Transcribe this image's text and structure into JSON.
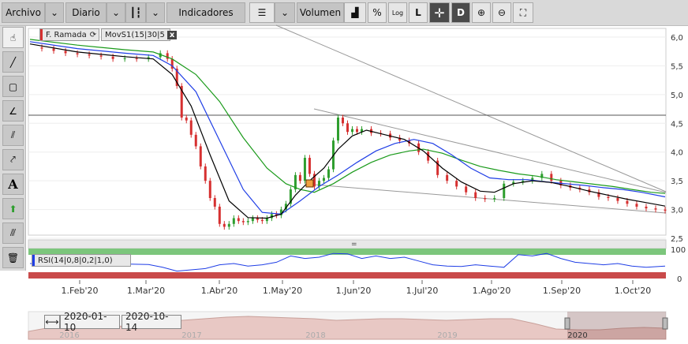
{
  "toolbar": {
    "archivo": "Archivo",
    "diario": "Diario",
    "indicadores": "Indicadores",
    "volumen": "Volumen",
    "percent": "%",
    "log": "Log"
  },
  "legend": {
    "main_series": "F. Ramada",
    "indicator": "MovS1(15|30|5",
    "close": "x",
    "rsi": "RSI(14|0,8|0,2|1,0)"
  },
  "colors": {
    "up": "#2e9e2e",
    "down": "#d63030",
    "ma_short": "#000000",
    "ma_mid": "#1f3ee6",
    "ma_long": "#1a9a1a",
    "rsi_line": "#1f3ee6",
    "rsi_high_band": "#7cc67c",
    "rsi_low_band": "#c94a4a"
  },
  "chart_data": {
    "type": "candlestick",
    "y_ticks": [
      "6,0",
      "5,5",
      "5,0",
      "4,5",
      "4,0",
      "3,5",
      "3,0",
      "2,5"
    ],
    "ylim": [
      2.5,
      6.0
    ],
    "x_ticks": [
      "1.Feb'20",
      "1.Mar'20",
      "1.Abr'20",
      "1.May'20",
      "1.Jun'20",
      "1.Jul'20",
      "1.Ago'20",
      "1.Sep'20",
      "1.Oct'20"
    ],
    "rsi_ticks": [
      "100",
      "0"
    ],
    "price": [
      [
        0,
        5.82
      ],
      [
        5,
        5.8
      ],
      [
        10,
        5.76
      ],
      [
        15,
        5.72
      ],
      [
        20,
        5.7
      ],
      [
        25,
        5.68
      ],
      [
        30,
        5.66
      ],
      [
        35,
        5.62
      ],
      [
        40,
        5.63
      ],
      [
        45,
        5.62
      ],
      [
        50,
        5.65
      ],
      [
        55,
        5.72
      ],
      [
        58,
        5.62
      ],
      [
        60,
        5.45
      ],
      [
        62,
        5.15
      ],
      [
        64,
        4.6
      ],
      [
        66,
        4.55
      ],
      [
        68,
        4.3
      ],
      [
        70,
        4.1
      ],
      [
        72,
        3.75
      ],
      [
        74,
        3.5
      ],
      [
        76,
        3.2
      ],
      [
        78,
        3.05
      ],
      [
        80,
        2.75
      ],
      [
        82,
        2.7
      ],
      [
        84,
        2.75
      ],
      [
        86,
        2.85
      ],
      [
        88,
        2.8
      ],
      [
        90,
        2.78
      ],
      [
        92,
        2.8
      ],
      [
        94,
        2.85
      ],
      [
        96,
        2.82
      ],
      [
        98,
        2.8
      ],
      [
        100,
        2.85
      ],
      [
        102,
        2.92
      ],
      [
        104,
        2.9
      ],
      [
        106,
        3.0
      ],
      [
        108,
        3.1
      ],
      [
        110,
        3.35
      ],
      [
        112,
        3.6
      ],
      [
        114,
        3.5
      ],
      [
        116,
        3.9
      ],
      [
        118,
        3.62
      ],
      [
        120,
        3.4
      ],
      [
        122,
        3.5
      ],
      [
        124,
        3.55
      ],
      [
        126,
        3.7
      ],
      [
        128,
        4.2
      ],
      [
        130,
        4.6
      ],
      [
        132,
        4.5
      ],
      [
        134,
        4.35
      ],
      [
        136,
        4.4
      ],
      [
        138,
        4.35
      ],
      [
        140,
        4.4
      ],
      [
        144,
        4.33
      ],
      [
        148,
        4.32
      ],
      [
        152,
        4.25
      ],
      [
        156,
        4.2
      ],
      [
        160,
        4.15
      ],
      [
        164,
        4.0
      ],
      [
        168,
        3.85
      ],
      [
        172,
        3.6
      ],
      [
        176,
        3.5
      ],
      [
        180,
        3.4
      ],
      [
        184,
        3.3
      ],
      [
        188,
        3.2
      ],
      [
        192,
        3.18
      ],
      [
        196,
        3.2
      ],
      [
        200,
        3.45
      ],
      [
        204,
        3.48
      ],
      [
        208,
        3.5
      ],
      [
        212,
        3.55
      ],
      [
        216,
        3.62
      ],
      [
        220,
        3.5
      ],
      [
        224,
        3.42
      ],
      [
        228,
        3.38
      ],
      [
        232,
        3.35
      ],
      [
        236,
        3.3
      ],
      [
        240,
        3.22
      ],
      [
        244,
        3.2
      ],
      [
        248,
        3.15
      ],
      [
        252,
        3.1
      ],
      [
        256,
        3.05
      ],
      [
        260,
        3.02
      ],
      [
        264,
        3.0
      ],
      [
        268,
        2.98
      ]
    ],
    "ma_short": [
      [
        0,
        5.88
      ],
      [
        20,
        5.74
      ],
      [
        40,
        5.66
      ],
      [
        52,
        5.62
      ],
      [
        60,
        5.35
      ],
      [
        68,
        4.8
      ],
      [
        76,
        3.95
      ],
      [
        84,
        3.15
      ],
      [
        92,
        2.86
      ],
      [
        100,
        2.85
      ],
      [
        106,
        2.92
      ],
      [
        112,
        3.25
      ],
      [
        118,
        3.5
      ],
      [
        124,
        3.72
      ],
      [
        130,
        4.05
      ],
      [
        136,
        4.28
      ],
      [
        142,
        4.38
      ],
      [
        150,
        4.3
      ],
      [
        158,
        4.22
      ],
      [
        166,
        4.02
      ],
      [
        174,
        3.72
      ],
      [
        182,
        3.48
      ],
      [
        190,
        3.32
      ],
      [
        196,
        3.3
      ],
      [
        204,
        3.45
      ],
      [
        212,
        3.5
      ],
      [
        220,
        3.47
      ],
      [
        228,
        3.4
      ],
      [
        236,
        3.32
      ],
      [
        244,
        3.25
      ],
      [
        252,
        3.18
      ],
      [
        260,
        3.12
      ],
      [
        268,
        3.06
      ]
    ],
    "ma_mid": [
      [
        0,
        5.92
      ],
      [
        20,
        5.8
      ],
      [
        40,
        5.72
      ],
      [
        52,
        5.68
      ],
      [
        60,
        5.5
      ],
      [
        70,
        5.05
      ],
      [
        80,
        4.2
      ],
      [
        90,
        3.35
      ],
      [
        98,
        2.95
      ],
      [
        106,
        2.92
      ],
      [
        114,
        3.15
      ],
      [
        122,
        3.4
      ],
      [
        130,
        3.6
      ],
      [
        138,
        3.82
      ],
      [
        146,
        4.02
      ],
      [
        154,
        4.15
      ],
      [
        162,
        4.22
      ],
      [
        170,
        4.15
      ],
      [
        178,
        3.95
      ],
      [
        186,
        3.72
      ],
      [
        194,
        3.55
      ],
      [
        202,
        3.52
      ],
      [
        210,
        3.52
      ],
      [
        218,
        3.48
      ],
      [
        226,
        3.45
      ],
      [
        234,
        3.42
      ],
      [
        242,
        3.38
      ],
      [
        250,
        3.35
      ],
      [
        258,
        3.3
      ],
      [
        268,
        3.22
      ]
    ],
    "ma_long": [
      [
        0,
        5.96
      ],
      [
        20,
        5.86
      ],
      [
        40,
        5.78
      ],
      [
        52,
        5.74
      ],
      [
        60,
        5.62
      ],
      [
        70,
        5.35
      ],
      [
        80,
        4.88
      ],
      [
        90,
        4.25
      ],
      [
        100,
        3.72
      ],
      [
        108,
        3.45
      ],
      [
        114,
        3.35
      ],
      [
        120,
        3.3
      ],
      [
        128,
        3.45
      ],
      [
        136,
        3.65
      ],
      [
        144,
        3.82
      ],
      [
        152,
        3.95
      ],
      [
        160,
        4.02
      ],
      [
        166,
        4.05
      ],
      [
        174,
        3.98
      ],
      [
        182,
        3.86
      ],
      [
        190,
        3.75
      ],
      [
        198,
        3.68
      ],
      [
        206,
        3.62
      ],
      [
        214,
        3.58
      ],
      [
        222,
        3.52
      ],
      [
        230,
        3.48
      ],
      [
        238,
        3.44
      ],
      [
        246,
        3.4
      ],
      [
        254,
        3.35
      ],
      [
        262,
        3.3
      ],
      [
        268,
        3.28
      ]
    ],
    "rsi": [
      [
        0,
        50
      ],
      [
        10,
        48
      ],
      [
        20,
        45
      ],
      [
        30,
        44
      ],
      [
        40,
        48
      ],
      [
        50,
        46
      ],
      [
        56,
        35
      ],
      [
        62,
        20
      ],
      [
        68,
        25
      ],
      [
        74,
        30
      ],
      [
        80,
        45
      ],
      [
        86,
        50
      ],
      [
        92,
        40
      ],
      [
        98,
        45
      ],
      [
        104,
        55
      ],
      [
        110,
        80
      ],
      [
        116,
        70
      ],
      [
        122,
        75
      ],
      [
        128,
        90
      ],
      [
        134,
        88
      ],
      [
        140,
        70
      ],
      [
        146,
        80
      ],
      [
        152,
        70
      ],
      [
        158,
        75
      ],
      [
        164,
        60
      ],
      [
        170,
        45
      ],
      [
        176,
        40
      ],
      [
        182,
        38
      ],
      [
        188,
        45
      ],
      [
        194,
        40
      ],
      [
        200,
        35
      ],
      [
        206,
        85
      ],
      [
        212,
        80
      ],
      [
        218,
        90
      ],
      [
        224,
        70
      ],
      [
        230,
        55
      ],
      [
        236,
        50
      ],
      [
        242,
        45
      ],
      [
        248,
        50
      ],
      [
        254,
        40
      ],
      [
        260,
        35
      ],
      [
        268,
        40
      ]
    ],
    "nav_range": [
      "2020-01-10",
      "2020-10-14"
    ],
    "nav_years": [
      "2016",
      "2017",
      "2018",
      "2019",
      "2020"
    ]
  }
}
